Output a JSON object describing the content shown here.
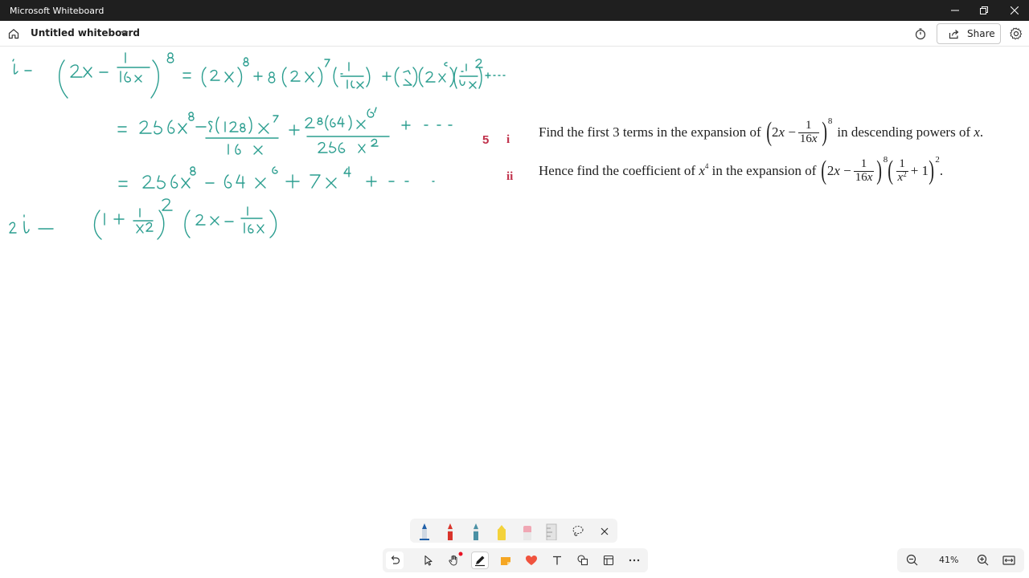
{
  "window": {
    "title": "Microsoft Whiteboard"
  },
  "header": {
    "board_title": "Untitled whiteboard",
    "share_label": "Share"
  },
  "question": {
    "number": "5",
    "part_i": {
      "label": "i",
      "text_before": "Find the first 3 terms in the expansion of",
      "text_after": "in descending powers of"
    },
    "part_ii": {
      "label": "ii",
      "text_before": "Hence find the coefficient of",
      "text_mid": "in the expansion of"
    }
  },
  "ink": {
    "line1": "i -  (2x − 1/16x)⁸ = (2x)⁸ + 8(2x)⁷(−1/16x) + (8 2)(2x)⁶(1/16x)² + ...",
    "line2": "= 256x⁸ − 8(128)x⁷/16x + 28(64)x⁶/256x² + ...",
    "line3": "= 256x⁸ − 64x⁶ + 7x⁴ + ...",
    "line4": "ii - (1 + 1/x²)² (2x − 1/16x)",
    "color": "#2a9d8f"
  },
  "zoom": {
    "value": "41%"
  },
  "pen_colors": {
    "blue": "#1f5fa8",
    "red": "#d9342b",
    "teal": "#4a90a4",
    "yellow": "#f3d23b",
    "pink": "#f0a7b4",
    "notify": "#e81123"
  }
}
